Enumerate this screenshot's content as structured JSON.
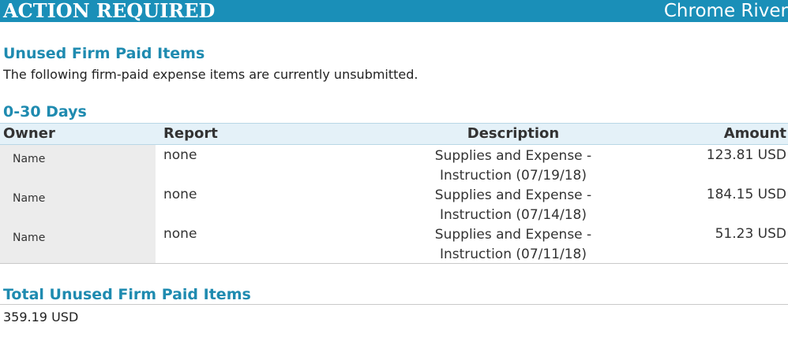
{
  "banner": {
    "title": "ACTION REQUIRED",
    "brand": "Chrome River"
  },
  "section": {
    "heading": "Unused Firm Paid Items",
    "intro": "The following firm-paid expense items are currently unsubmitted."
  },
  "group": {
    "heading": "0-30 Days",
    "columns": {
      "owner": "Owner",
      "report": "Report",
      "description": "Description",
      "amount": "Amount"
    },
    "rows": [
      {
        "owner": "Name",
        "report": "none",
        "description_line1": "Supplies and Expense -",
        "description_line2": "Instruction (07/19/18)",
        "amount": "123.81 USD"
      },
      {
        "owner": "Name",
        "report": "none",
        "description_line1": "Supplies and Expense -",
        "description_line2": "Instruction (07/14/18)",
        "amount": "184.15 USD"
      },
      {
        "owner": "Name",
        "report": "none",
        "description_line1": "Supplies and Expense -",
        "description_line2": "Instruction (07/11/18)",
        "amount": "51.23 USD"
      }
    ]
  },
  "total": {
    "heading": "Total Unused Firm Paid Items",
    "value": "359.19 USD"
  },
  "colors": {
    "banner_bg": "#1a8fb8",
    "heading_text": "#1f8bb0",
    "header_row_bg": "#e4f1f8",
    "owner_col_bg": "#ececec"
  }
}
